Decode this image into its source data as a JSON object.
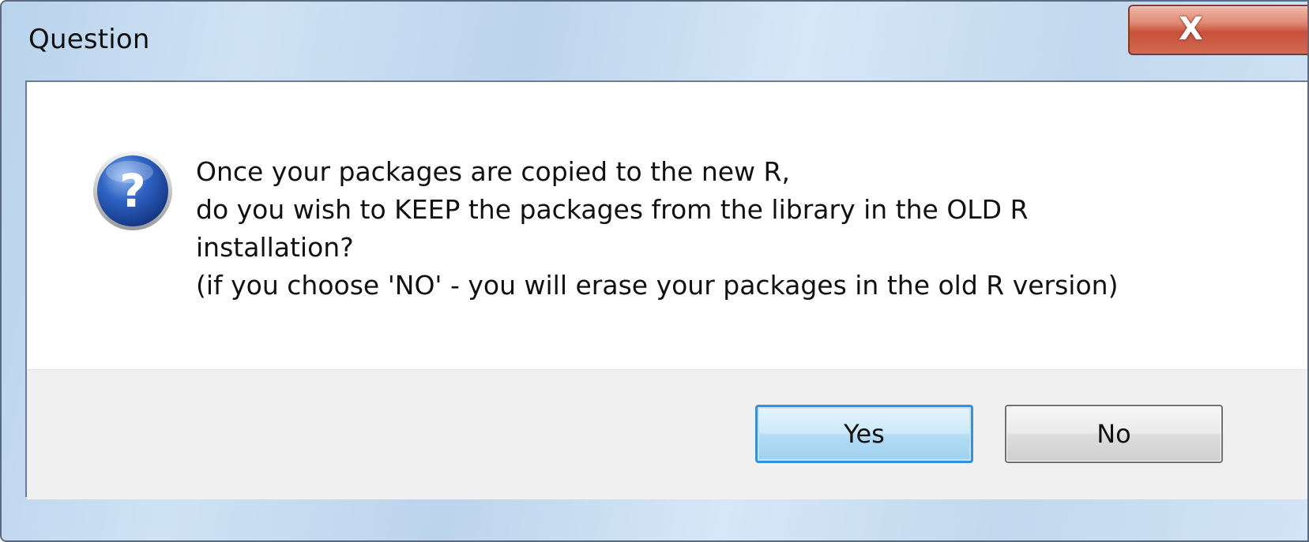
{
  "window": {
    "title": "Question",
    "close_glyph": "X"
  },
  "dialog": {
    "icon": "question-icon",
    "message_lines": [
      "Once your packages are copied to the new R,",
      "do you wish to KEEP the packages from the library in the OLD R",
      "installation?",
      "(if you choose 'NO' - you will erase your packages in the old R version)"
    ]
  },
  "buttons": {
    "yes_label": "Yes",
    "no_label": "No"
  },
  "colors": {
    "title_bar": "#c6dcf2",
    "close_button": "#c8503a",
    "default_button_border": "#3c8fd0",
    "button_strip": "#f0f0f0"
  }
}
